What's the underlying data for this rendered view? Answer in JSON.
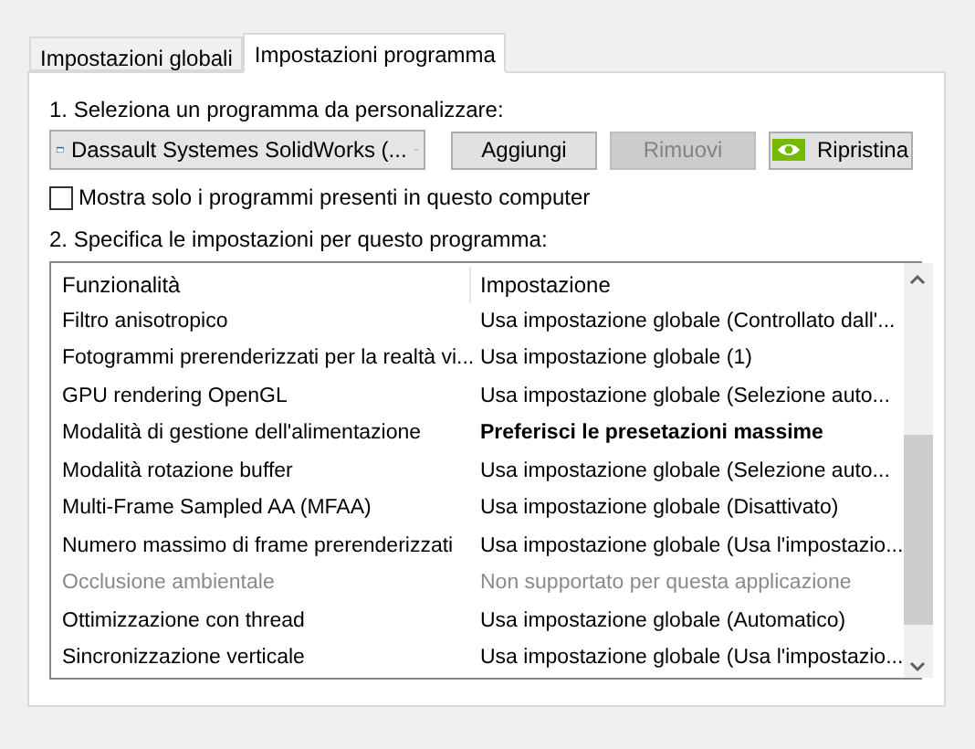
{
  "tabs": [
    {
      "label": "Impostazioni globali",
      "selected": false
    },
    {
      "label": "Impostazioni programma",
      "selected": true
    }
  ],
  "step_1": {
    "label": "1. Seleziona un programma da personalizzare:",
    "program": "Dassault Systemes SolidWorks (...",
    "buttons": [
      {
        "label": "Aggiungi",
        "disabled": false,
        "kind": "plain"
      },
      {
        "label": "Rimuovi",
        "disabled": true,
        "kind": "plain"
      },
      {
        "label": "Ripristina",
        "disabled": false,
        "kind": "logo"
      }
    ]
  },
  "show_installed_only": {
    "label": "Mostra solo i programmi presenti in questo computer",
    "checked": false
  },
  "step_2": {
    "label": "2. Specifica le impostazioni per questo programma:",
    "columns": [
      "Funzionalità",
      "Impostazione"
    ],
    "rows": [
      {
        "feature": "Filtro anisotropico",
        "setting": "Usa impostazione globale (Controllato dall'...",
        "modified": false,
        "disabled": false
      },
      {
        "feature": "Fotogrammi prerenderizzati per la realtà vi...",
        "setting": "Usa impostazione globale (1)",
        "modified": false,
        "disabled": false
      },
      {
        "feature": "GPU rendering OpenGL",
        "setting": "Usa impostazione globale (Selezione auto...",
        "modified": false,
        "disabled": false
      },
      {
        "feature": "Modalità di gestione dell'alimentazione",
        "setting": "Preferisci le presetazioni massime",
        "modified": true,
        "disabled": false
      },
      {
        "feature": "Modalità rotazione buffer",
        "setting": "Usa impostazione globale (Selezione auto...",
        "modified": false,
        "disabled": false
      },
      {
        "feature": "Multi-Frame Sampled AA (MFAA)",
        "setting": "Usa impostazione globale (Disattivato)",
        "modified": false,
        "disabled": false
      },
      {
        "feature": "Numero massimo di frame prerenderizzati",
        "setting": "Usa impostazione globale (Usa l'impostazio...",
        "modified": false,
        "disabled": false
      },
      {
        "feature": "Occlusione ambientale",
        "setting": "Non supportato per questa applicazione",
        "modified": false,
        "disabled": true
      },
      {
        "feature": "Ottimizzazione con thread",
        "setting": "Usa impostazione globale (Automatico)",
        "modified": false,
        "disabled": false
      },
      {
        "feature": "Sincronizzazione verticale",
        "setting": "Usa impostazione globale (Usa l'impostazio...",
        "modified": false,
        "disabled": false
      }
    ]
  }
}
